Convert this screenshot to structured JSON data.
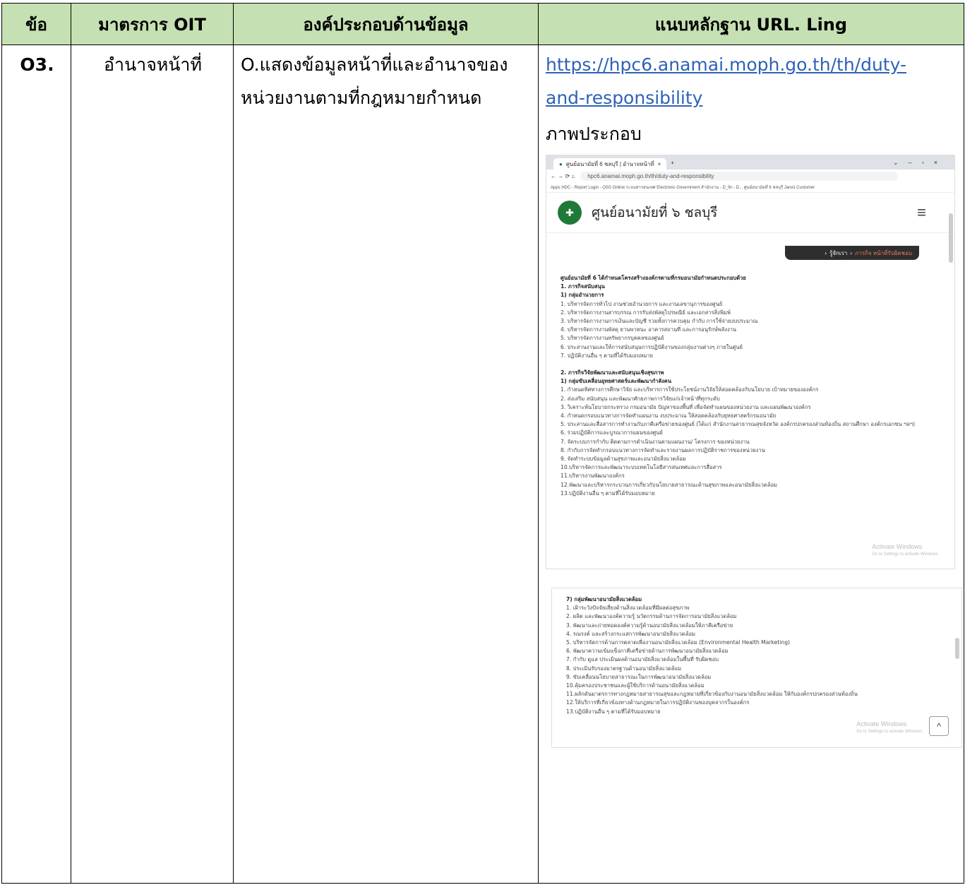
{
  "table": {
    "headers": [
      "ข้อ",
      "มาตรการ OIT",
      "องค์ประกอบด้านข้อมูล",
      "แนบหลักฐาน URL. Ling"
    ],
    "row": {
      "no": "O3.",
      "measure": "อำนาจหน้าที่",
      "element": "O.แสดงข้อมูลหน้าที่และอำนาจของหน่วยงานตามที่กฎหมายกำหนด",
      "url_line1": "https://hpc6.anamai.moph.go.th/th/duty-",
      "url_line2": "and-responsibility",
      "caption": "ภาพประกอบ"
    }
  },
  "screenshot": {
    "tab_title": "ศูนย์อนามัยที่ 6 ชลบุรี | อำนาจหน้าที่",
    "address": "hpc6.anamai.moph.go.th/th/duty-and-responsibility",
    "bookmarks": "Apps   HDC - Report   Login - OSS Online   ระบบสารสนเทศ   Electronic Government   สำนักงาน - D_fin - D...   ศูนย์อนามัยที่ 6 ชลบุรี   Jarvis Customer",
    "site_title": "ศูนย์อนามัยที่ ๖ ชลบุรี",
    "breadcrumb_1": "รู้จักเรา",
    "breadcrumb_2": "ภารกิจ หน้าที่รับผิดชอบ",
    "intro": "ศูนย์อนามัยที่ 6 ได้กำหนดโครงสร้างองค์กรตามที่กรมอนามัยกำหนดประกอบด้วย",
    "sec1": "1. ภารกิจสนับสนุน",
    "sec1_group": "1) กลุ่มอำนวยการ",
    "sec1_items": [
      "1. บริหารจัดการทั่วไป งานช่วยอำนวยการ และงานเลขานุการของศูนย์",
      "2. บริหารจัดการงานสารบรรณ การรับส่งพัสดุไปรษณีย์ และเอกสารสิ่งพิมพ์",
      "3. บริหารจัดการงานการเงินและบัญชี รวมทั้งการควบคุม กำกับ การใช้จ่ายงบประมาณ",
      "4. บริหารจัดการงานพัสดุ ยานพาหนะ อาคารสถานที่ และการอนุรักษ์พลังงาน",
      "5. บริหารจัดการงานทรัพยากรบุคคลของศูนย์",
      "6. ประสานงานและให้การสนับสนุนการปฏิบัติงานของกลุ่มงานต่างๆ ภายในศูนย์",
      "7. ปฏิบัติงานอื่น ๆ ตามที่ได้รับมอบหมาย"
    ],
    "sec2": "2. ภารกิจวิจัยพัฒนาและสนับสนุนเชิงสุขภาพ",
    "sec2_group": "1) กลุ่มขับเคลื่อนยุทธศาสตร์และพัฒนากำลังคน",
    "sec2_items": [
      "1. กำหนดทิศทางการศึกษาวิจัย และบริหารการใช้ประโยชน์งานวิจัยให้สอดคล้องกับนโยบาย เป้าหมายขององค์กร",
      "2. ส่งเสริม สนับสนุน และพัฒนาศักยภาพการวิจัยแก่เจ้าหน้าที่ทุกระดับ",
      "3. วิเคราะห์นโยบายกระทรวง กรมอนามัย ปัญหาของพื้นที่ เพื่อจัดทำแผนของหน่วยงาน และแผนพัฒนาองค์กร",
      "4. กำหนดกรอบแนวทางการจัดทำแผนงาน งบประมาณ ให้สอดคล้องกับยุทธศาสตร์กรมอนามัย",
      "5. ประสานและสื่อสารการทำงานกับภาคีเครือข่ายของศูนย์ (ได้แก่ สำนักงานสาธารณสุขจังหวัด องค์กรปกครองส่วนท้องถิ่น สถานศึกษา องค์กรเอกชน ฯลฯ)",
      "6. ร่วมปฏิบัติการและบูรณาการแผนของศูนย์",
      "7. จัดระบบการกำกับ ติดตามการดำเนินงานตามแผนงาน/ โครงการ ของหน่วยงาน",
      "8. กำกับการจัดทำกรอบแนวทางการจัดทำและรายงานผลการปฏิบัติราชการของหน่วยงาน",
      "9. จัดทำระบบข้อมูลด้านสุขภาพและอนามัยสิ่งแวดล้อม",
      "10.บริหารจัดการและพัฒนาระบบเทคโนโลยีสารสนเทศและการสื่อสาร",
      "11.บริหารงานพัฒนาองค์กร",
      "12.พัฒนาและบริหารกระบวนการเกี่ยวกับนโยบายสาธารณะด้านสุขภาพและอนามัยสิ่งแวดล้อม",
      "13.ปฏิบัติงานอื่น ๆ ตามที่ได้รับมอบหมาย"
    ],
    "sec7_group": "7) กลุ่มพัฒนาอนามัยสิ่งแวดล้อม",
    "sec7_items": [
      "1. เฝ้าระวังปัจจัยเสี่ยงด้านสิ่งแวดล้อมที่มีผลต่อสุขภาพ",
      "2. ผลิต และพัฒนาองค์ความรู้ นวัตกรรมด้านการจัดการอนามัยสิ่งแวดล้อม",
      "3. พัฒนาและถ่ายทอดองค์ความรู้ด้านอนามัยสิ่งแวดล้อมให้ภาคีเครือข่าย",
      "4. รณรงค์ และสร้างกระแสการพัฒนาอนามัยสิ่งแวดล้อม",
      "5. บริหารจัดการด้านการตลาดเพื่องานอนามัยสิ่งแวดล้อม (Environmental Health Marketing)",
      "6. พัฒนาความเข้มแข็งภาคีเครือข่ายด้านการพัฒนาอนามัยสิ่งแวดล้อม",
      "7. กำกับ ดูแล ประเมินผลด้านอนามัยสิ่งแวดล้อมในพื้นที่ รับผิดชอบ",
      "8. ประเมินรับรองมาตรฐานด้านอนามัยสิ่งแวดล้อม",
      "9. ขับเคลื่อนนโยบายสาธารณะในการพัฒนาอนามัยสิ่งแวดล้อม",
      "10.คุ้มครองประชาชนและผู้ใช้บริการด้านอนามัยสิ่งแวดล้อม",
      "11.ผลักดันมาตรการทางกฎหมายสาธารณสุขและกฎหมายที่เกี่ยวข้องกับงานอนามัยสิ่งแวดล้อม ให้กับองค์กรปกครองส่วนท้องถิ่น",
      "12.ให้บริการที่เกี่ยวข้องทางด้านกฎหมายในการปฏิบัติงานของบุคลากรในองค์กร",
      "13.ปฏิบัติงานอื่น ๆ ตามที่ได้รับมอบหมาย"
    ],
    "watermark_1": "Activate Windows",
    "watermark_2": "Go to Settings to activate Windows."
  }
}
